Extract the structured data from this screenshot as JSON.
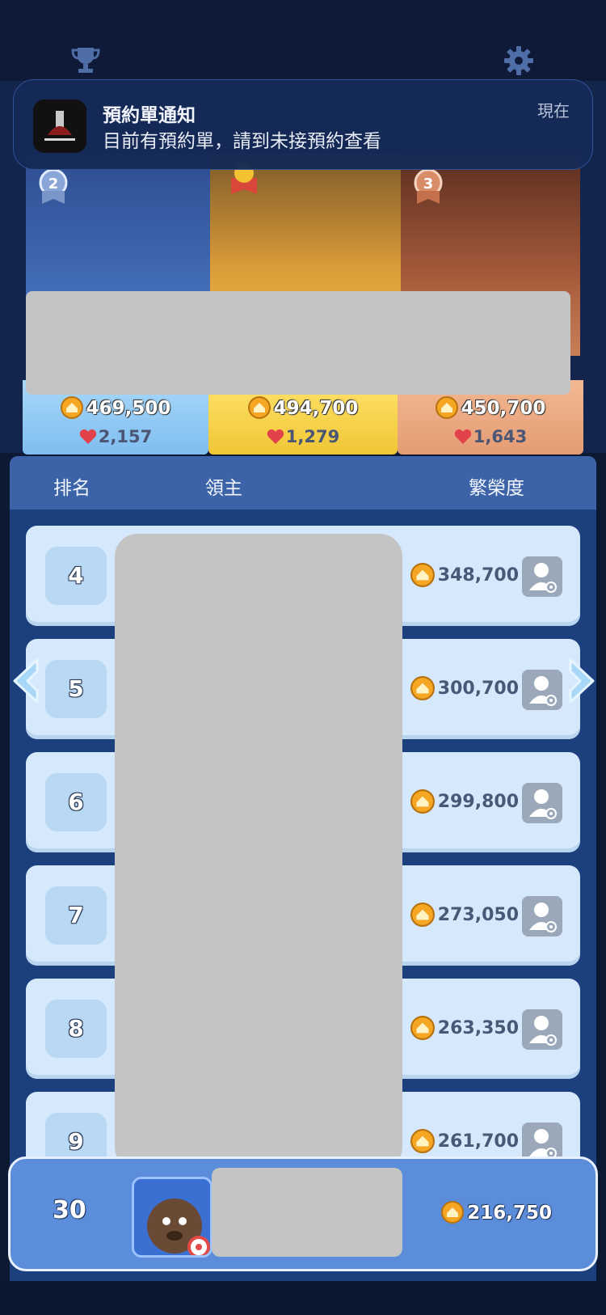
{
  "notification": {
    "title": "預約單通知",
    "body": "目前有預約單，請到未接預約查看",
    "time": "現在"
  },
  "podium": [
    {
      "place": "2",
      "score": "469,500",
      "likes": "2,157"
    },
    {
      "place": "1",
      "score": "494,700",
      "likes": "1,279"
    },
    {
      "place": "3",
      "score": "450,700",
      "likes": "1,643"
    }
  ],
  "table_header": {
    "rank": "排名",
    "lord": "領主",
    "prosperity": "繁榮度"
  },
  "rows": [
    {
      "rank": "4",
      "score": "348,700"
    },
    {
      "rank": "5",
      "score": "300,700"
    },
    {
      "rank": "6",
      "score": "299,800"
    },
    {
      "rank": "7",
      "score": "273,050"
    },
    {
      "rank": "8",
      "score": "263,350"
    },
    {
      "rank": "9",
      "score": "261,700"
    }
  ],
  "self": {
    "rank": "30",
    "score": "216,750"
  },
  "colors": {
    "board": "#1c3f7e",
    "header": "#3c63a8",
    "row": "#d6e9fc",
    "self_bar": "#5b8ddb",
    "gold": "#f0c636"
  },
  "icons": [
    "trophy-icon",
    "gear-icon",
    "coin-icon",
    "heart-icon",
    "view-profile-icon",
    "arrow-left-icon",
    "arrow-right-icon"
  ]
}
